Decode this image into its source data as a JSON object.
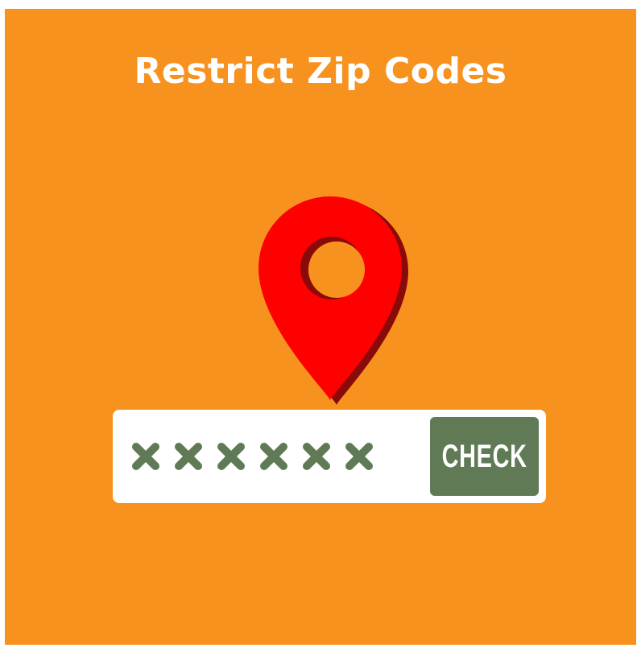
{
  "title": "Restrict Zip Codes",
  "pin": {
    "icon": "map-pin-icon",
    "color": "#ff0000",
    "shadow_color": "#8a0a0a"
  },
  "zip_input": {
    "mask_icon": "x-mark-icon",
    "mask_count": 6,
    "mask_color": "#5f7a55"
  },
  "check_button": {
    "label": "CHECK",
    "color": "#5f7a55"
  },
  "colors": {
    "background": "#f7921e",
    "text": "#ffffff"
  }
}
